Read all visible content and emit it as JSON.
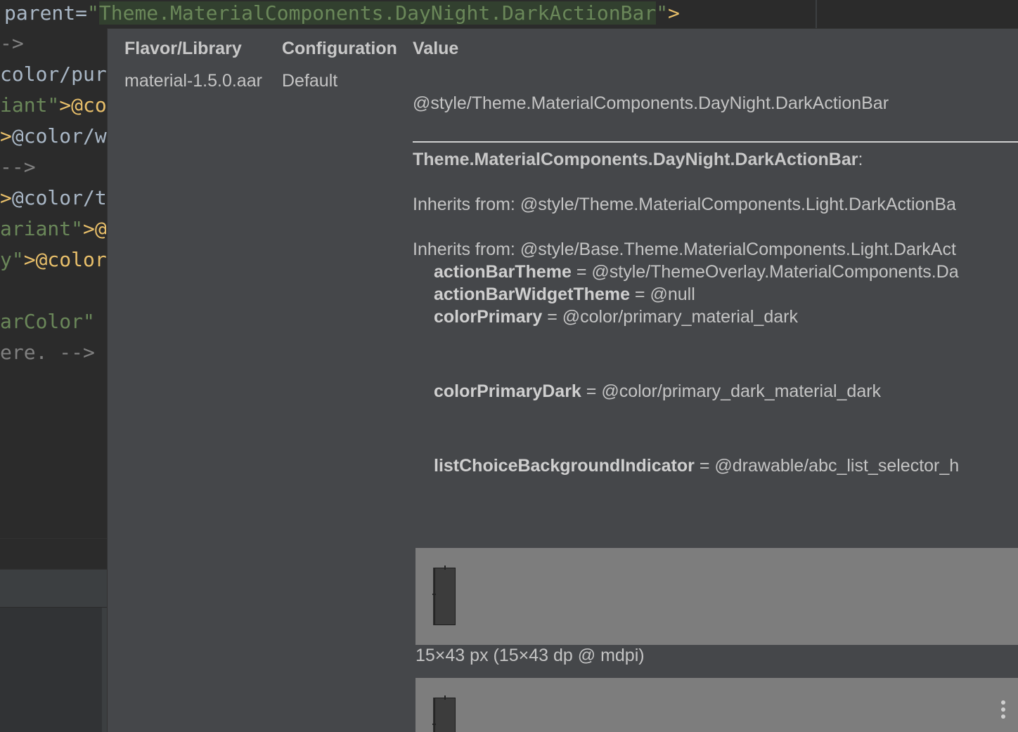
{
  "editor": {
    "top_line": {
      "attr": "parent=",
      "quote_open": "\"",
      "value": "Theme.MaterialComponents.DayNight.DarkActionBar",
      "quote_close": "\"",
      "tag_close": ">"
    },
    "lines": [
      {
        "a": "",
        "b": "->",
        "cls": "c-com"
      },
      {
        "a": "color/pur",
        "b": "",
        "cls": "c-val"
      },
      {
        "a": "iant\"",
        "b": ">@co",
        "cls": "c-str"
      },
      {
        "a": ">",
        "b": "@color/w",
        "cls": "c-tag"
      },
      {
        "a": " -->",
        "b": "",
        "cls": "c-com"
      },
      {
        "a": ">",
        "b": "@color/t",
        "cls": "c-tag"
      },
      {
        "a": "ariant\"",
        "b": ">@",
        "cls": "c-str"
      },
      {
        "a": "y\"",
        "b": ">@color",
        "cls": "c-str"
      },
      {
        "a": "",
        "b": "",
        "cls": "c-com"
      },
      {
        "a": "arColor\"",
        "b": "",
        "cls": "c-str"
      },
      {
        "a": "ere. -->",
        "b": "",
        "cls": "c-com"
      }
    ]
  },
  "popup": {
    "headers": {
      "flavor": "Flavor/Library",
      "configuration": "Configuration",
      "value": "Value"
    },
    "row": {
      "flavor": "material-1.5.0.aar",
      "configuration": "Default"
    },
    "style_ref": "@style/Theme.MaterialComponents.DayNight.DarkActionBar",
    "theme_name": "Theme.MaterialComponents.DayNight.DarkActionBar",
    "theme_suffix": ":",
    "inherits_1": "Inherits from: @style/Theme.MaterialComponents.Light.DarkActionBa",
    "inherits_2": "Inherits from: @style/Base.Theme.MaterialComponents.Light.DarkAct",
    "attributes": [
      {
        "key": "actionBarTheme",
        "value": " = @style/ThemeOverlay.MaterialComponents.Da"
      },
      {
        "key": "actionBarWidgetTheme",
        "value": " = @null"
      },
      {
        "key": "colorPrimary",
        "value": " = @color/primary_material_dark"
      },
      {
        "key": "colorPrimaryDark",
        "value": " = @color/primary_dark_material_dark"
      },
      {
        "key": "listChoiceBackgroundIndicator",
        "value": " = @drawable/abc_list_selector_h"
      }
    ],
    "preview_dims": "15×43 px (15×43 dp @ mdpi)"
  },
  "colors": {
    "editor_bg": "#2b2b2b",
    "popup_bg": "#45474a",
    "string_green": "#6a8759",
    "tag_yellow": "#e8bf6a",
    "preview_bg": "#7d7d7d"
  },
  "icons": {
    "more": "more-vertical-icon"
  }
}
